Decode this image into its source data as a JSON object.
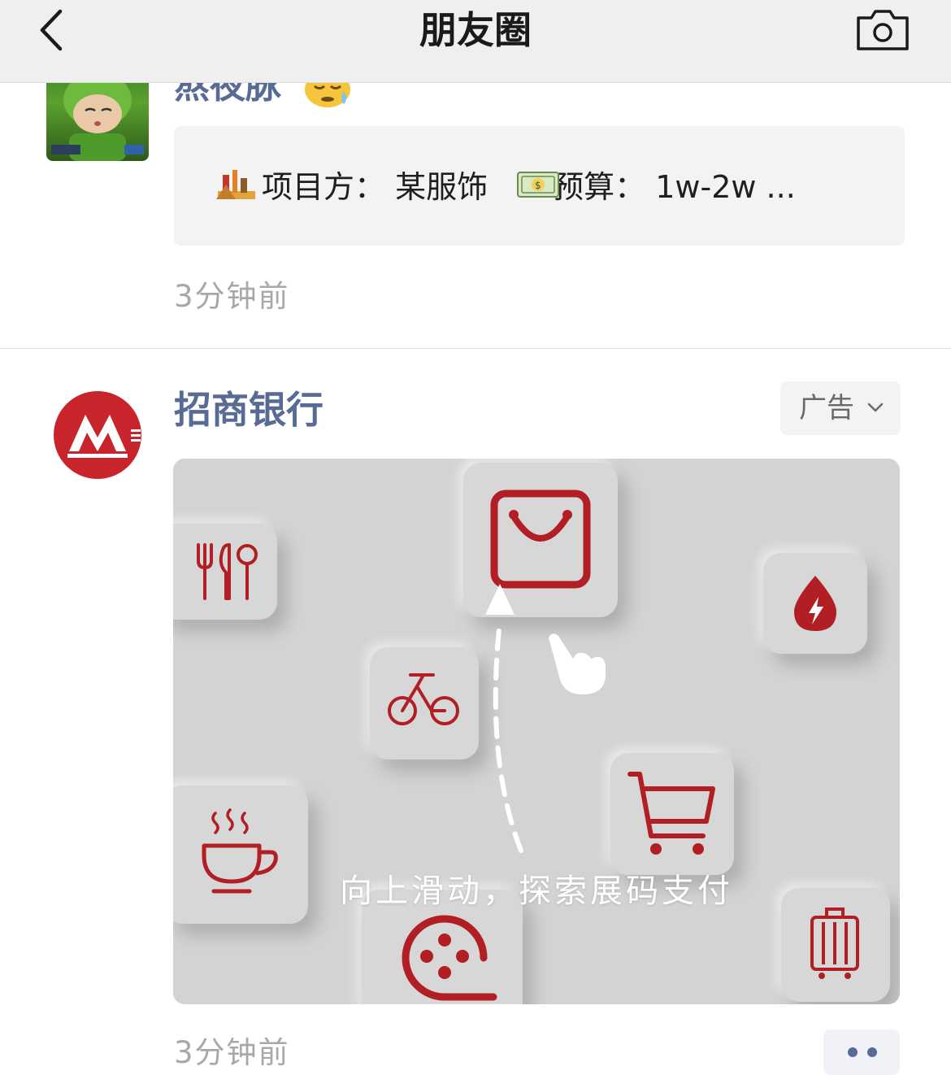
{
  "nav": {
    "title": "朋友圈",
    "back_icon": "chevron-left-icon",
    "camera_icon": "camera-icon"
  },
  "post1": {
    "author": "熬夜脉",
    "author_emoji": "sleepy-face-emoji",
    "card_text": "项目方： 某服饰 ",
    "card_text_2": "预算： 1w-2w  ...",
    "time": "3分钟前"
  },
  "post2": {
    "author": "招商银行",
    "ad_label": "广告",
    "banner_caption": "向上滑动，探索展码支付",
    "time": "3分钟前",
    "brand_color": "#b11f24",
    "link_color": "#576b95"
  }
}
